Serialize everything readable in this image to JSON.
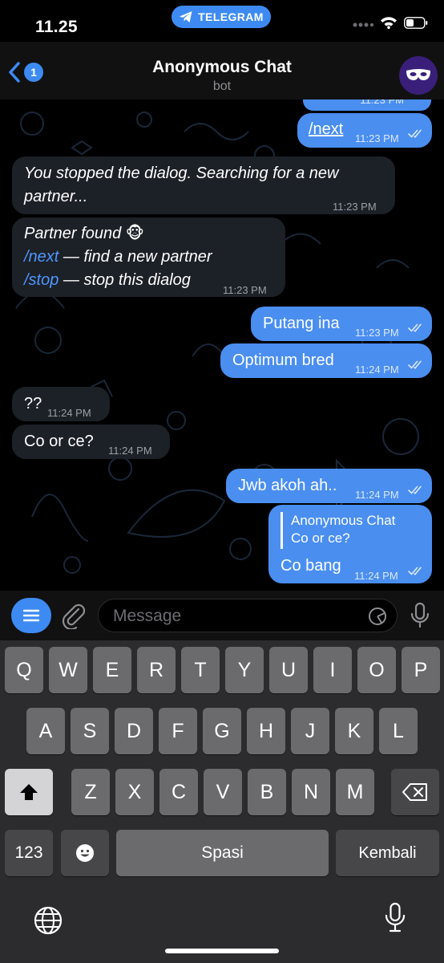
{
  "status": {
    "time": "11.25",
    "pill_label": "TELEGRAM"
  },
  "nav": {
    "back_count": "1",
    "title": "Anonymous Chat",
    "subtitle": "bot"
  },
  "messages": {
    "m0": {
      "time": "11:23 PM"
    },
    "m1": {
      "text": "/next",
      "time": "11:23 PM"
    },
    "m2": {
      "line1": "You stopped the dialog. Searching for a new",
      "line2": "partner...",
      "time": "11:23 PM"
    },
    "m3": {
      "line1": "Partner found",
      "emoji": "🐵",
      "cmd_next": "/next",
      "next_desc": " — find a new partner",
      "cmd_stop": "/stop",
      "stop_desc": " — stop this dialog",
      "time": "11:23 PM"
    },
    "m4": {
      "text": "Putang ina",
      "time": "11:23 PM"
    },
    "m5": {
      "text": "Optimum bred",
      "time": "11:24 PM"
    },
    "m6": {
      "text": "??",
      "time": "11:24 PM"
    },
    "m7": {
      "text": "Co or ce?",
      "time": "11:24 PM"
    },
    "m8": {
      "text": "Jwb akoh ah..",
      "time": "11:24 PM"
    },
    "m9": {
      "reply_name": "Anonymous Chat",
      "reply_text": "Co or ce?",
      "text": "Co bang",
      "time": "11:24 PM"
    }
  },
  "input": {
    "placeholder": "Message"
  },
  "keyboard": {
    "row1": [
      "Q",
      "W",
      "E",
      "R",
      "T",
      "Y",
      "U",
      "I",
      "O",
      "P"
    ],
    "row2": [
      "A",
      "S",
      "D",
      "F",
      "G",
      "H",
      "J",
      "K",
      "L"
    ],
    "row3": [
      "Z",
      "X",
      "C",
      "V",
      "B",
      "N",
      "M"
    ],
    "numbers_label": "123",
    "space_label": "Spasi",
    "return_label": "Kembali"
  },
  "colors": {
    "accent": "#3d8bf2",
    "outgoing_bubble": "#4a8ef0",
    "incoming_bubble": "#1c2027"
  }
}
